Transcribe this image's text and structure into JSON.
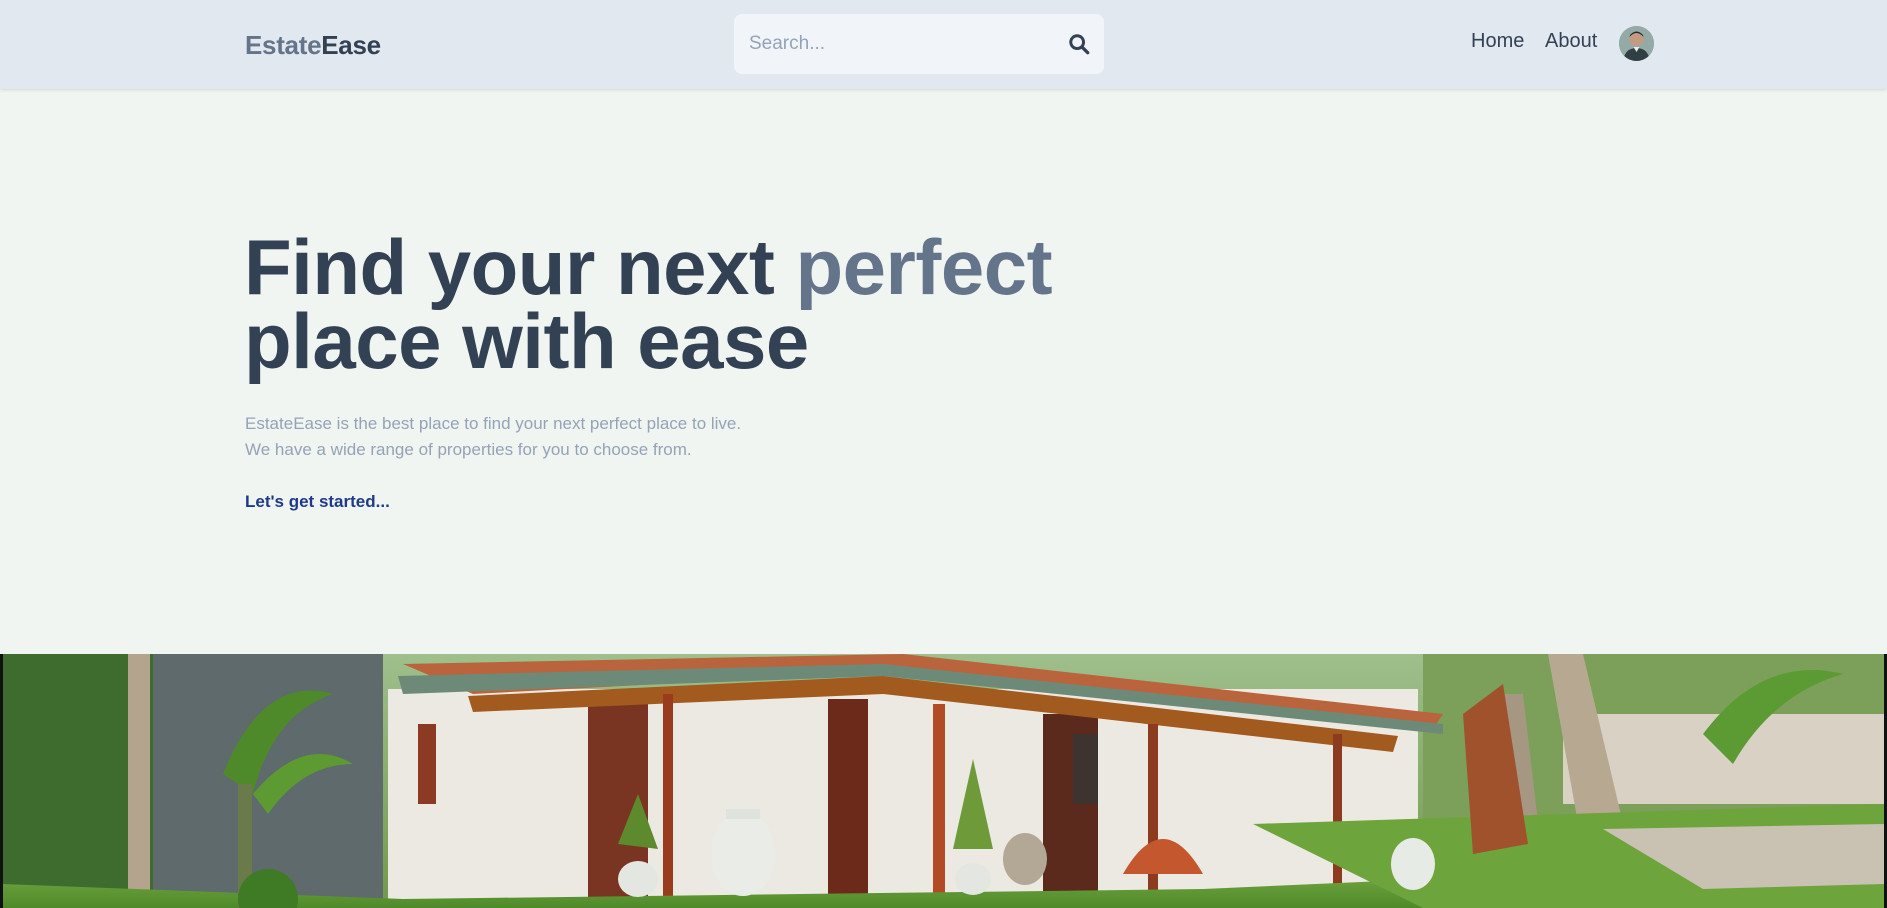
{
  "header": {
    "brand_part1": "Estate",
    "brand_part2": "Ease",
    "search_placeholder": "Search...",
    "search_icon": "search-icon",
    "nav": {
      "home": "Home",
      "about": "About"
    },
    "avatar_icon": "user-avatar"
  },
  "hero": {
    "title_part1": "Find your next ",
    "title_accent": "perfect",
    "title_part2": "place with ease",
    "desc_line1": "EstateEase is the best place to find your next perfect place to live.",
    "desc_line2": "We have a wide range of properties for you to choose from.",
    "cta": "Let's get started..."
  },
  "colors": {
    "header_bg": "#e2e8f0",
    "page_bg": "#f1f5f1",
    "text_dark": "#334155",
    "text_accent": "#64748b",
    "text_muted": "#94a3b8",
    "link": "#1e3a8a"
  }
}
